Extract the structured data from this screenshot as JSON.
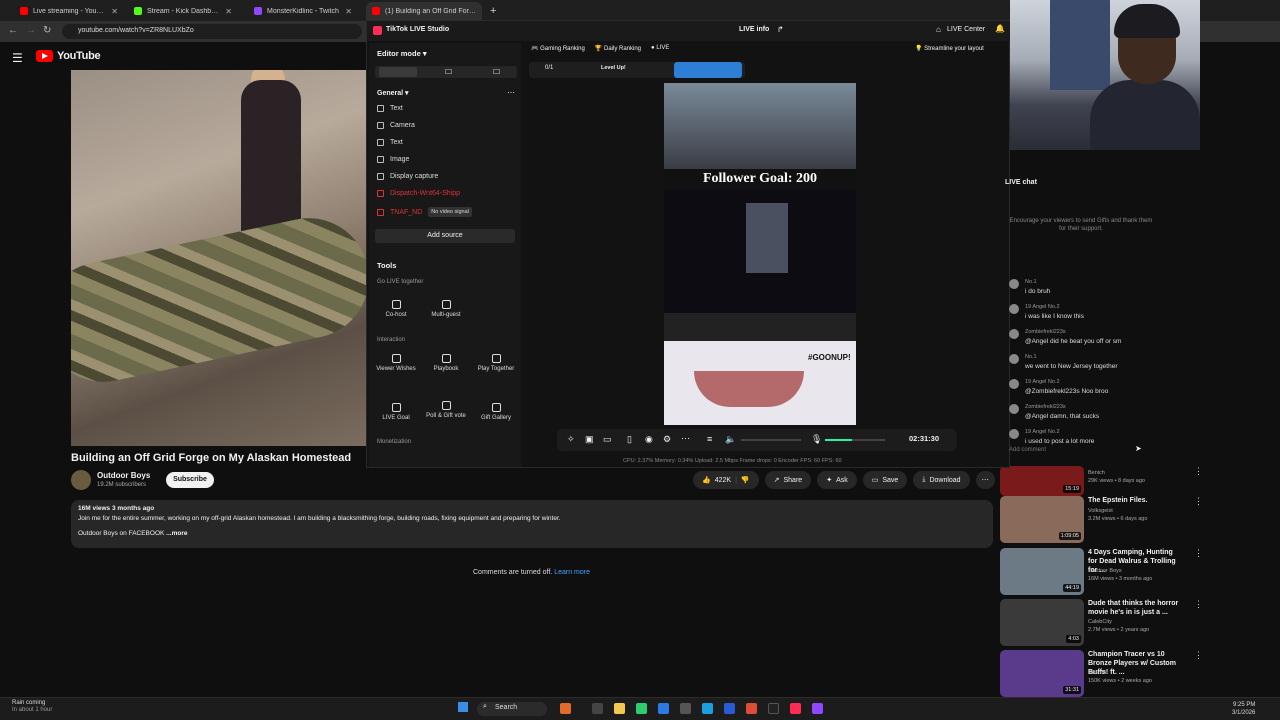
{
  "browser": {
    "tabs": [
      {
        "label": "Live streaming - YouTube Studio",
        "color": "#ff0000"
      },
      {
        "label": "Stream - Kick Dashboard",
        "color": "#53fc18"
      },
      {
        "label": "MonsterKidlinc - Twitch",
        "color": "#9146ff"
      },
      {
        "label": "(1) Building an Off Grid Forge o",
        "color": "#ff0000"
      }
    ],
    "url": "youtube.com/watch?v=ZR8NLUXbZo"
  },
  "youtube": {
    "logo_text": "YouTube",
    "video_title": "Building an Off Grid Forge on My Alaskan Homestead",
    "channel": "Outdoor Boys",
    "subscribers": "19.2M subscribers",
    "subscribe_label": "Subscribe",
    "actions": {
      "likes": "422K",
      "share": "Share",
      "ask": "Ask",
      "save": "Save",
      "download": "Download"
    },
    "description": {
      "meta": "16M views 3 months ago",
      "text": "Join me for the entire summer, working on my off-grid Alaskan homestead. I am building a blacksmithing forge, building roads, fixing equipment and preparing for winter.",
      "more_prefix": "Outdoor Boys on FACEBOOK",
      "more": "...more"
    },
    "comments_off": "Comments are turned off.",
    "learn_more": "Learn more"
  },
  "tiktok": {
    "app_title": "TikTok LIVE Studio",
    "live_info": "LIVE info",
    "live_center": "LIVE Center",
    "editor_mode": "Editor mode",
    "general": "General",
    "sources": [
      "Text",
      "Camera",
      "Text",
      "Image",
      "Display capture",
      "Dispatch-Wnt64-Shipp",
      "TNAF_ND"
    ],
    "no_video_signal": "No video signal",
    "add_source": "Add source",
    "tools": "Tools",
    "go_live_together": "Go LIVE together",
    "co_host": "Co-host",
    "multi_guest": "Multi-guest",
    "interaction": "Interaction",
    "viewer_wishes": "Viewer Wishes",
    "playbook": "Playbook",
    "play_together": "Play Together",
    "live_goal": "LIVE Goal",
    "poll_gift": "Poll & Gift vote",
    "gift_gallery": "Gift Gallery",
    "monetization": "Monetization",
    "gaming_ranking": "Gaming Ranking",
    "daily_ranking": "Daily Ranking",
    "live_tag": "LIVE",
    "streamline": "Streamline your layout",
    "counter": "0/1",
    "level_up": "Level Up!",
    "follower_goal": "Follower Goal: 200",
    "goonup": "#GOONUP!",
    "timer": "02:31:30",
    "status": "CPU: 2.37%     Memory: 0.34%     Upload: 2.5 Mbps     Frame drops: 0     Encoder FPS: 60     FPS: 60",
    "chat_title": "LIVE chat",
    "chat_hint": "Encourage your viewers to send Gifts and thank them for their support.",
    "add_comment": "Add comment",
    "chat": [
      {
        "name": "No.1",
        "text": "i do bruh"
      },
      {
        "name": "19  Angel  No.2",
        "text": "i was like I know this"
      },
      {
        "name": "Zombiefrekl223s",
        "text": "@Angel did he beat you off or sm"
      },
      {
        "name": "No.1",
        "text": "we went to New Jersey together"
      },
      {
        "name": "19  Angel  No.2",
        "text": "@Zombiefrekl223s Noo broo"
      },
      {
        "name": "Zombiefrekl223s",
        "text": "@Angel damn, that sucks"
      },
      {
        "name": "19  Angel  No.2",
        "text": "i used to post a lot more"
      }
    ]
  },
  "recommended": [
    {
      "title": "IT'S OVER",
      "channel": "Benich",
      "meta": "29K views • 8 days ago",
      "duration": "15:19",
      "color": "#7a1a1a"
    },
    {
      "title": "The Epstein Files.",
      "channel": "Volksgeist",
      "meta": "3.2M views • 6 days ago",
      "badge": "New",
      "duration": "1:09:05",
      "color": "#8a6a5a"
    },
    {
      "title": "4 Days Camping, Hunting for Dead Walrus & Trolling for ...",
      "channel": "Outdoor Boys",
      "meta": "16M views • 3 months ago",
      "duration": "44:19",
      "color": "#6b7a84"
    },
    {
      "title": "Dude that thinks the horror movie he's in is just a ...",
      "channel": "CalebCity",
      "meta": "2.7M views • 2 years ago",
      "duration": "4:03",
      "color": "#3a3a3a"
    },
    {
      "title": "Champion Tracer vs 10 Bronze Players w/ Custom Buffs! ft. ...",
      "channel": "Jarvofo",
      "meta": "150K views • 2 weeks ago",
      "duration": "31:31",
      "color": "#5a3a8a"
    }
  ],
  "taskbar": {
    "weather_title": "Rain coming",
    "weather_sub": "In about 1 hour",
    "search": "Search",
    "time": "9:25 PM",
    "date": "3/1/2026"
  }
}
